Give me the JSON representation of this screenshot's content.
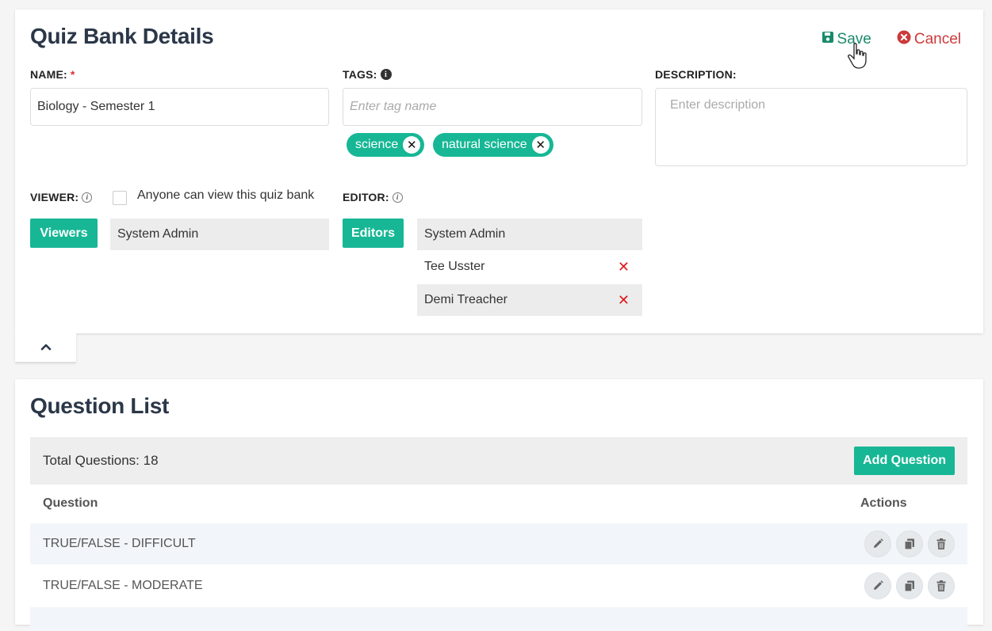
{
  "details": {
    "title": "Quiz Bank Details",
    "save_label": "Save",
    "cancel_label": "Cancel",
    "name_label": "NAME:",
    "name_required": "*",
    "name_value": "Biology - Semester 1",
    "tags_label": "TAGS:",
    "tags_placeholder": "Enter tag name",
    "tags": [
      {
        "label": "science"
      },
      {
        "label": "natural science"
      }
    ],
    "description_label": "DESCRIPTION:",
    "description_placeholder": "Enter description",
    "viewer_label": "VIEWER:",
    "anyone_view_label": "Anyone can view this quiz bank",
    "viewers_button": "Viewers",
    "viewers": [
      "System Admin"
    ],
    "editor_label": "EDITOR:",
    "editors_button": "Editors",
    "editors": [
      {
        "name": "System Admin",
        "removable": false
      },
      {
        "name": "Tee Usster",
        "removable": true
      },
      {
        "name": "Demi Treacher",
        "removable": true
      }
    ]
  },
  "question_list": {
    "title": "Question List",
    "total_label": "Total Questions: 18",
    "add_button": "Add Question",
    "col_question": "Question",
    "col_actions": "Actions",
    "rows": [
      {
        "question": "TRUE/FALSE - DIFFICULT"
      },
      {
        "question": "TRUE/FALSE - MODERATE"
      }
    ]
  },
  "colors": {
    "accent": "#17b795",
    "save": "#1a8a6a",
    "cancel": "#cc3a3a",
    "remove": "#e0191b"
  },
  "icons": [
    "floppy-disk-icon",
    "times-circle-icon",
    "info-icon",
    "chevron-up-icon",
    "pencil-icon",
    "copy-icon",
    "trash-icon",
    "hand-cursor-icon"
  ]
}
